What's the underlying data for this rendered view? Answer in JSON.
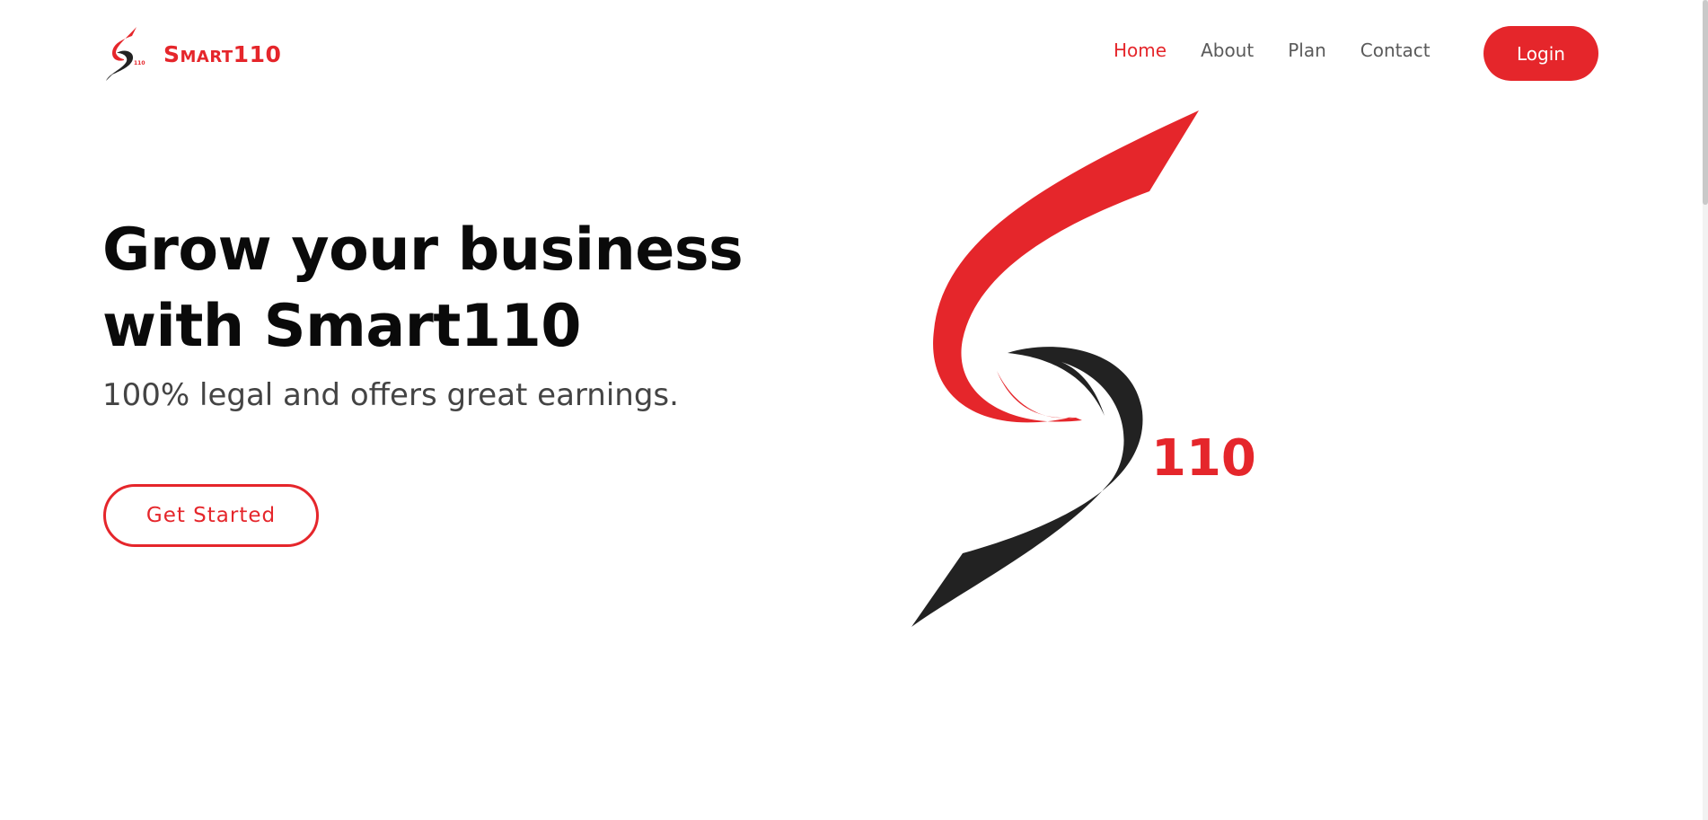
{
  "brand": {
    "name": "Smart110",
    "mark_text": "110",
    "primary_color": "#e5262b",
    "dark_color": "#222222"
  },
  "nav": {
    "items": [
      {
        "label": "Home",
        "active": true
      },
      {
        "label": "About",
        "active": false
      },
      {
        "label": "Plan",
        "active": false
      },
      {
        "label": "Contact",
        "active": false
      }
    ],
    "login_label": "Login"
  },
  "hero": {
    "title_line1": "Grow your business",
    "title_line2": "with Smart110",
    "subtitle": "100% legal and offers great earnings.",
    "cta_label": "Get Started",
    "logo_text": "110"
  }
}
